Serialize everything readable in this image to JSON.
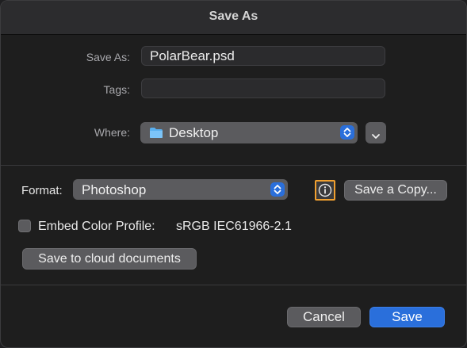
{
  "window": {
    "title": "Save As"
  },
  "fields": {
    "save_as_label": "Save As:",
    "save_as_value": "PolarBear.psd",
    "tags_label": "Tags:",
    "tags_value": "",
    "where_label": "Where:",
    "where_value": "Desktop",
    "where_icon": "folder-icon"
  },
  "format": {
    "label": "Format:",
    "selected": "Photoshop"
  },
  "info_button": {
    "icon": "info-icon",
    "highlight_color": "#f0a030"
  },
  "save_copy_label": "Save a Copy...",
  "embed": {
    "label": "Embed Color Profile:",
    "profile": "sRGB IEC61966-2.1",
    "checked": false
  },
  "cloud_button_label": "Save to cloud documents",
  "actions": {
    "cancel_label": "Cancel",
    "save_label": "Save"
  },
  "colors": {
    "accent": "#2a6fdb"
  }
}
